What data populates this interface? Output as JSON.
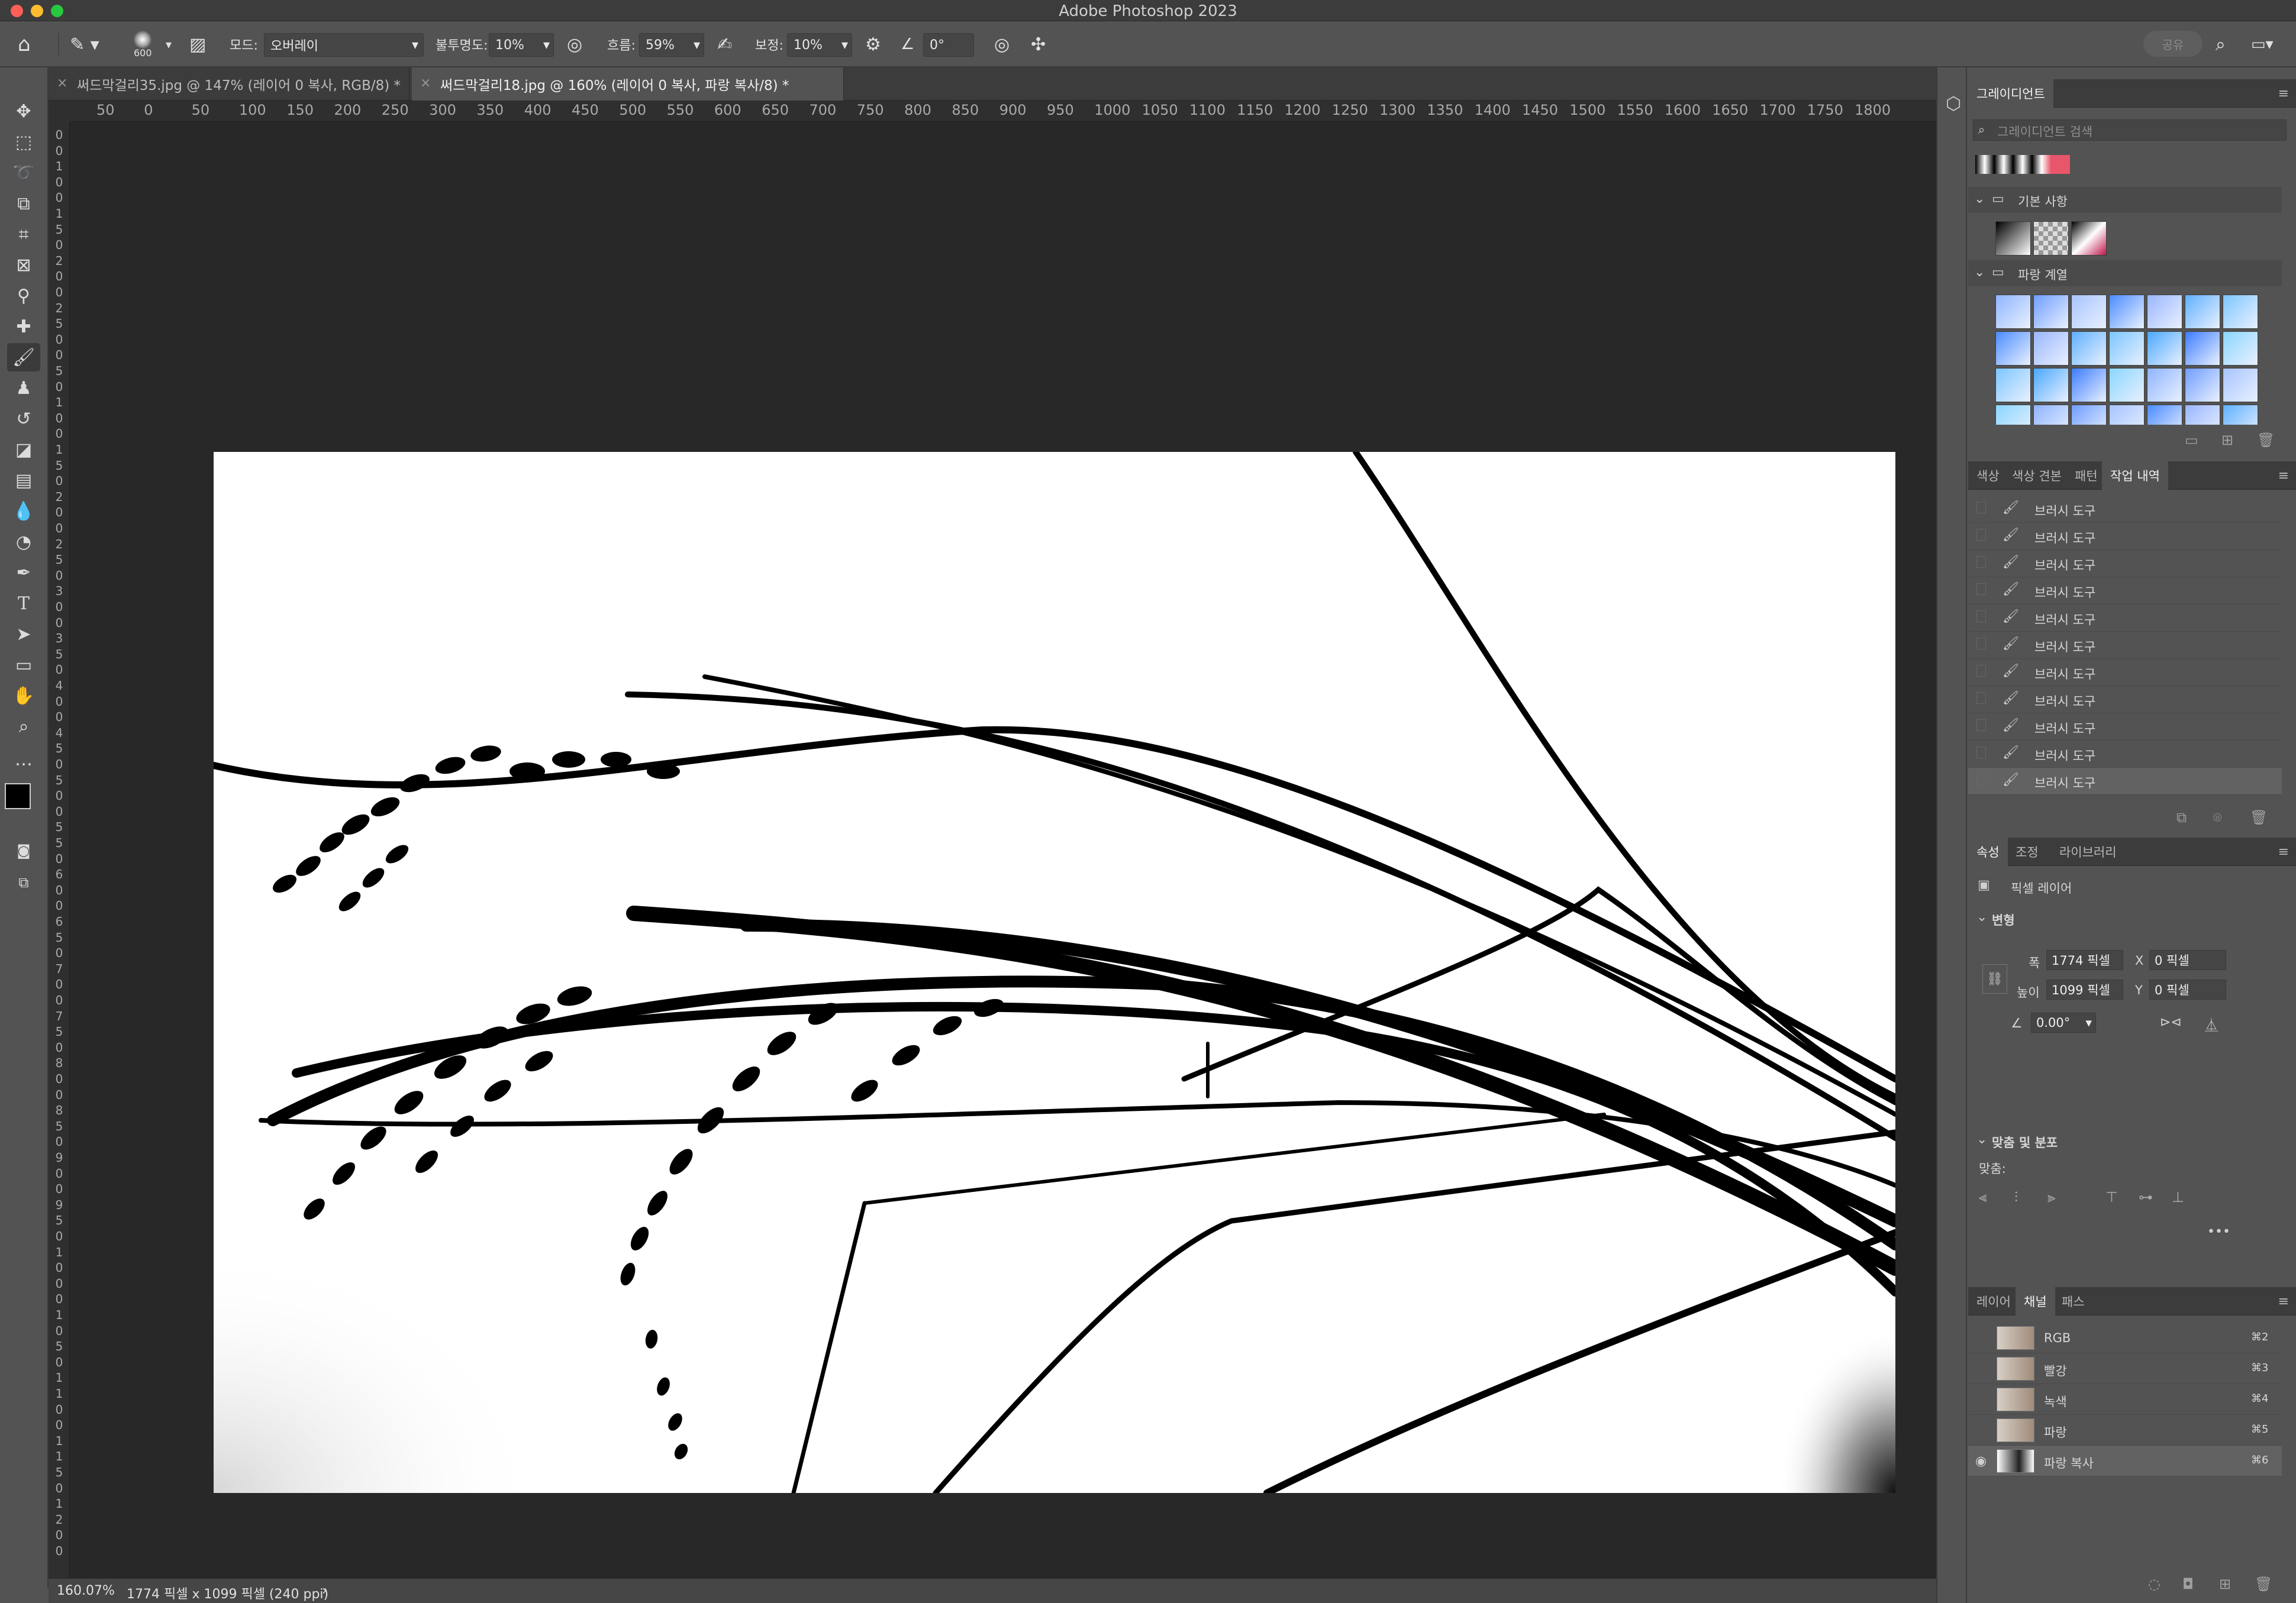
{
  "app": {
    "title": "Adobe Photoshop 2023"
  },
  "options": {
    "brush_size": "600",
    "mode_label": "모드:",
    "mode_value": "오버레이",
    "opacity_label": "불투명도:",
    "opacity_value": "10%",
    "flow_label": "흐름:",
    "flow_value": "59%",
    "smoothing_label": "보정:",
    "smoothing_value": "10%",
    "angle_value": "0°",
    "share_label": "공유"
  },
  "tabs": [
    {
      "label": "써드막걸리35.jpg @ 147% (레이어 0 복사, RGB/8) *"
    },
    {
      "label": "써드막걸리18.jpg @ 160% (레이어 0 복사, 파랑 복사/8) *"
    }
  ],
  "ruler": {
    "h_ticks": [
      "50",
      "0",
      "50",
      "100",
      "150",
      "200",
      "250",
      "300",
      "350",
      "400",
      "450",
      "500",
      "550",
      "600",
      "650",
      "700",
      "750",
      "800",
      "850",
      "900",
      "950",
      "1000",
      "1050",
      "1100",
      "1150",
      "1200",
      "1250",
      "1300",
      "1350",
      "1400",
      "1450",
      "1500",
      "1550",
      "1600",
      "1650",
      "1700",
      "1750",
      "1800"
    ],
    "v_ticks": [
      "0",
      "0",
      "1",
      "0",
      "0",
      "1",
      "5",
      "0",
      "2",
      "0",
      "0",
      "2",
      "5",
      "0",
      "0",
      "5",
      "0",
      "1",
      "0",
      "0",
      "1",
      "5",
      "0",
      "2",
      "0",
      "0",
      "2",
      "5",
      "0",
      "3",
      "0",
      "0",
      "3",
      "5",
      "0",
      "4",
      "0",
      "0",
      "4",
      "5",
      "0",
      "5",
      "0",
      "0",
      "5",
      "5",
      "0",
      "6",
      "0",
      "0",
      "6",
      "5",
      "0",
      "7",
      "0",
      "0",
      "7",
      "5",
      "0",
      "8",
      "0",
      "0",
      "8",
      "5",
      "0",
      "9",
      "0",
      "0",
      "9",
      "5",
      "0",
      "1",
      "0",
      "0",
      "0",
      "1",
      "0",
      "5",
      "0",
      "1",
      "1",
      "0",
      "0",
      "1",
      "1",
      "5",
      "0",
      "1",
      "2",
      "0",
      "0"
    ]
  },
  "status": {
    "zoom": "160.07%",
    "doc_info": "1774 픽셀 x 1099 픽셀 (240 ppi)"
  },
  "gradients": {
    "tab": "그레이디언트",
    "search_placeholder": "그레이디언트 검색",
    "folder_basic": "기본 사항",
    "folder_blue": "파랑 계열"
  },
  "history": {
    "tabs": [
      "색상",
      "색상 견본",
      "패턴",
      "작업 내역"
    ],
    "items": [
      "브러시 도구",
      "브러시 도구",
      "브러시 도구",
      "브러시 도구",
      "브러시 도구",
      "브러시 도구",
      "브러시 도구",
      "브러시 도구",
      "브러시 도구",
      "브러시 도구",
      "브러시 도구"
    ]
  },
  "properties": {
    "tabs": [
      "속성",
      "조정",
      "라이브러리"
    ],
    "layer_type": "픽셀 레이어",
    "transform_title": "변형",
    "w_label": "폭",
    "w_value": "1774 픽셀",
    "h_label": "높이",
    "h_value": "1099 픽셀",
    "x_label": "X",
    "x_value": "0 픽셀",
    "y_label": "Y",
    "y_value": "0 픽셀",
    "angle_value": "0.00°",
    "align_title": "맞춤 및 분포",
    "align_label": "맞춤:"
  },
  "channels": {
    "tabs": [
      "레이어",
      "채널",
      "패스"
    ],
    "items": [
      {
        "name": "RGB",
        "shortcut": "⌘2"
      },
      {
        "name": "빨강",
        "shortcut": "⌘3"
      },
      {
        "name": "녹색",
        "shortcut": "⌘4"
      },
      {
        "name": "파랑",
        "shortcut": "⌘5"
      },
      {
        "name": "파랑 복사",
        "shortcut": "⌘6"
      }
    ]
  },
  "colors": {
    "accent_swatch": "#e8566b"
  }
}
